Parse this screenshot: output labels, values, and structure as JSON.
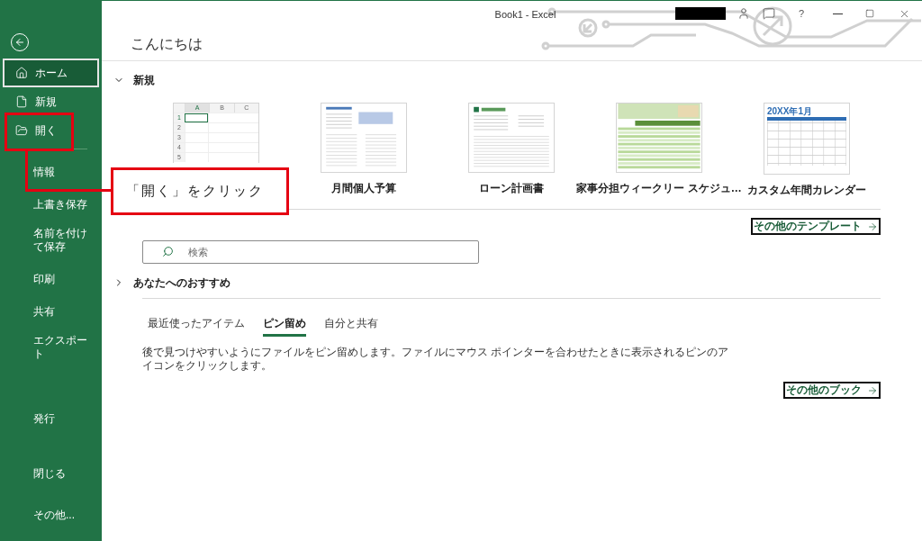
{
  "window": {
    "title": "Book1  -  Excel",
    "help": "?"
  },
  "sidebar": {
    "top_items": [
      {
        "label": "ホーム",
        "selected": true
      },
      {
        "label": "新規",
        "selected": false
      },
      {
        "label": "開く",
        "selected": false
      }
    ],
    "items": [
      {
        "label": "情報",
        "selected": false
      },
      {
        "label": "上書き保存",
        "selected": false
      },
      {
        "label": "名前を付けて保存",
        "selected": false
      },
      {
        "label": "印刷",
        "selected": false
      },
      {
        "label": "共有",
        "selected": false
      },
      {
        "label": "エクスポート",
        "selected": false
      },
      {
        "label": "発行",
        "selected": false
      },
      {
        "label": "閉じる",
        "selected": false
      },
      {
        "label": "その他...",
        "selected": false
      }
    ]
  },
  "greeting": "こんにちは",
  "new_section": {
    "title": "新規",
    "expanded": true,
    "templates": [
      {
        "kind": "blank",
        "columns": [
          "A",
          "B",
          "C"
        ],
        "rows": [
          "1",
          "2",
          "3",
          "4",
          "5"
        ]
      },
      {
        "kind": "budget",
        "label": "月間個人予算"
      },
      {
        "kind": "loan",
        "label": "ローン計画書"
      },
      {
        "kind": "chores",
        "label": "家事分担ウィークリー スケジュ…"
      },
      {
        "kind": "calendar",
        "label": "カスタム年間カレンダー",
        "heading": "20XX年1月"
      }
    ],
    "more_link": "その他のテンプレート"
  },
  "search": {
    "placeholder": "検索"
  },
  "recommended": {
    "title": "あなたへのおすすめ",
    "expanded": false
  },
  "tabs": [
    {
      "label": "最近使ったアイテム",
      "selected": false
    },
    {
      "label": "ピン留め",
      "selected": true
    },
    {
      "label": "自分と共有",
      "selected": false
    }
  ],
  "description": "後で見つけやすいようにファイルをピン留めします。ファイルにマウス ポインターを合わせたときに表示されるピンのアイコンをクリックします。",
  "more_books": "その他のブック",
  "annotation": {
    "text": "「開く」をクリック"
  }
}
